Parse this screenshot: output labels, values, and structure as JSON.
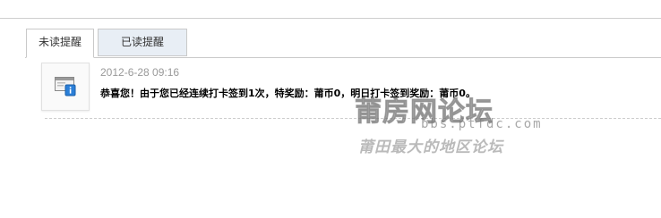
{
  "tabs": [
    {
      "label": "未读提醒",
      "active": true
    },
    {
      "label": "已读提醒",
      "active": false
    }
  ],
  "notice": {
    "avatar_icon": "system-notice-icon",
    "time": "2012-6-28 09:16",
    "text": "恭喜您！由于您已经连续打卡签到1次，特奖励：莆币0，明日打卡签到奖励：莆币0。"
  },
  "watermark": {
    "title": "莆房网论坛",
    "url": "bbs.ptfdc.com",
    "slogan": "莆田最大的地区论坛"
  },
  "colors": {
    "tab_inactive_bg": "#e8eef5",
    "border": "#c9c9c9",
    "time_text": "#999999"
  }
}
